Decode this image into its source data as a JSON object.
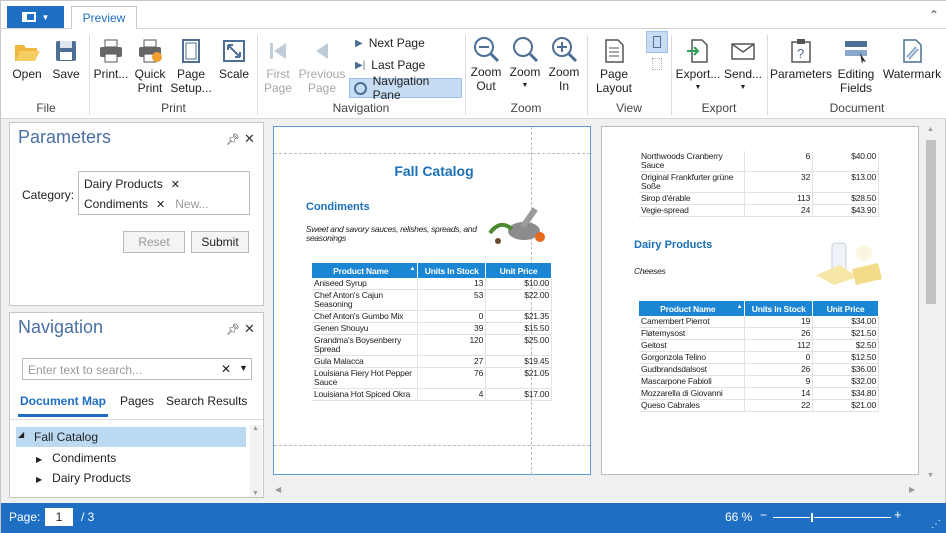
{
  "tabs": {
    "active": "Preview"
  },
  "ribbon": {
    "file": {
      "group": "File",
      "open": "Open",
      "save": "Save"
    },
    "print": {
      "group": "Print",
      "print": "Print...",
      "quick_print": "Quick Print",
      "page_setup": "Page Setup...",
      "scale": "Scale"
    },
    "navigation": {
      "group": "Navigation",
      "first_page": "First Page",
      "previous_page": "Previous Page",
      "next_page": "Next Page",
      "last_page": "Last Page",
      "navigation_pane": "Navigation Pane"
    },
    "zoom": {
      "group": "Zoom",
      "zoom_out": "Zoom Out",
      "zoom": "Zoom",
      "zoom_in": "Zoom In"
    },
    "view": {
      "group": "View",
      "page_layout": "Page Layout"
    },
    "export": {
      "group": "Export",
      "export": "Export...",
      "send": "Send..."
    },
    "document": {
      "group": "Document",
      "parameters": "Parameters",
      "editing_fields": "Editing Fields",
      "watermark": "Watermark"
    }
  },
  "parameters_panel": {
    "title": "Parameters",
    "category_label": "Category:",
    "tags": [
      "Dairy Products",
      "Condiments"
    ],
    "new_placeholder": "New...",
    "reset": "Reset",
    "submit": "Submit"
  },
  "navigation_panel": {
    "title": "Navigation",
    "search_placeholder": "Enter text to search...",
    "tabs": [
      "Document Map",
      "Pages",
      "Search Results"
    ],
    "tree": {
      "root": "Fall Catalog",
      "children": [
        "Condiments",
        "Dairy Products"
      ]
    }
  },
  "page1": {
    "title": "Fall Catalog",
    "category": "Condiments",
    "description": "Sweet and savory sauces, relishes, spreads, and seasonings",
    "headers": [
      "Product Name",
      "Units In Stock",
      "Unit Price"
    ],
    "rows": [
      [
        "Aniseed Syrup",
        "13",
        "$10.00"
      ],
      [
        "Chef Anton's Cajun Seasoning",
        "53",
        "$22.00"
      ],
      [
        "Chef Anton's Gumbo Mix",
        "0",
        "$21.35"
      ],
      [
        "Genen Shouyu",
        "39",
        "$15.50"
      ],
      [
        "Grandma's Boysenberry Spread",
        "120",
        "$25.00"
      ],
      [
        "Gula Malacca",
        "27",
        "$19.45"
      ],
      [
        "Louisiana Fiery Hot Pepper Sauce",
        "76",
        "$21.05"
      ],
      [
        "Louisiana Hot Spiced Okra",
        "4",
        "$17.00"
      ]
    ]
  },
  "page2": {
    "top_rows": [
      [
        "Northwoods Cranberry Sauce",
        "6",
        "$40.00"
      ],
      [
        "Original Frankfurter grüne Soße",
        "32",
        "$13.00"
      ],
      [
        "Sirop d'érable",
        "113",
        "$28.50"
      ],
      [
        "Vegie-spread",
        "24",
        "$43.90"
      ]
    ],
    "category": "Dairy Products",
    "description": "Cheeses",
    "headers": [
      "Product Name",
      "Units In Stock",
      "Unit Price"
    ],
    "rows": [
      [
        "Camembert Pierrot",
        "19",
        "$34.00"
      ],
      [
        "Fløtemysost",
        "26",
        "$21.50"
      ],
      [
        "Geitost",
        "112",
        "$2.50"
      ],
      [
        "Gorgonzola Telino",
        "0",
        "$12.50"
      ],
      [
        "Gudbrandsdalsost",
        "26",
        "$36.00"
      ],
      [
        "Mascarpone Fabioli",
        "9",
        "$32.00"
      ],
      [
        "Mozzarella di Giovanni",
        "14",
        "$34.80"
      ],
      [
        "Queso Cabrales",
        "22",
        "$21.00"
      ]
    ]
  },
  "status": {
    "page_label": "Page:",
    "page_value": "1",
    "page_total": "/ 3",
    "zoom": "66 %",
    "zoom_level": 0.66
  },
  "colors": {
    "accent": "#1e6fc4",
    "table_header": "#1a86d4",
    "heading": "#1a6fb7"
  }
}
